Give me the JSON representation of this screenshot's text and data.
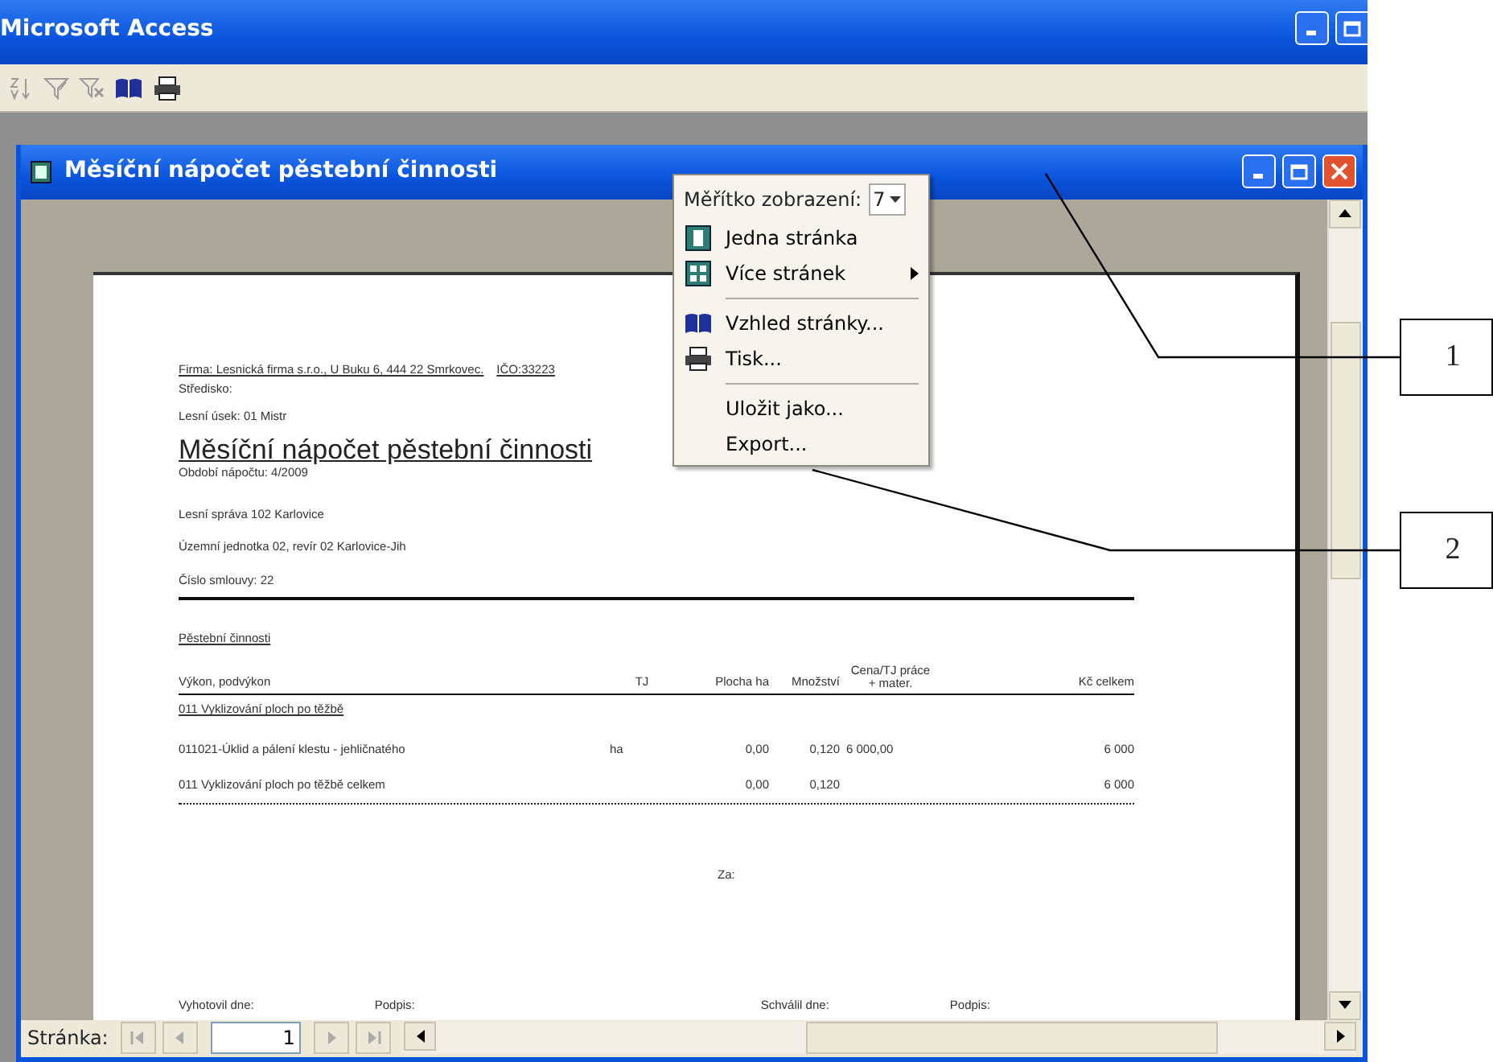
{
  "app": {
    "title": "Microsoft Access"
  },
  "toolbar": [
    {
      "kind": "sort",
      "disabled": true
    },
    {
      "kind": "filter",
      "disabled": true
    },
    {
      "kind": "remove-filter",
      "disabled": true
    },
    {
      "kind": "book",
      "disabled": false
    },
    {
      "kind": "print",
      "disabled": false
    }
  ],
  "document_window": {
    "title": "Měsíční nápočet pěstební činnosti"
  },
  "report": {
    "company": "Firma:  Lesnická firma s.r.o., U Buku 6, 444 22 Smrkovec.",
    "ico": "IČO:33223",
    "lines_top": [
      "Středisko:",
      "Lesní úsek: 01 Mistr"
    ],
    "title": "Měsíční nápočet pěstební činnosti",
    "period": "Období nápočtu:  4/2009",
    "lines_bottom": [
      "Lesní správa 102 Karlovice",
      "Územní jednotka 02, revír 02 Karlovice-Jih",
      "Číslo smlouvy:  22"
    ],
    "section": "Pěstební činnosti",
    "columns": [
      "Výkon, podvýkon",
      "TJ",
      "Plocha ha",
      "Množství",
      "Cena/TJ práce + mater.",
      "Kč celkem"
    ],
    "rows": [
      {
        "kind": "group",
        "cells": [
          "011  Vyklizování ploch po těžbě"
        ]
      },
      {
        "kind": "item",
        "cells": [
          "011021-Úklid a pálení klestu - jehličnatého",
          "ha",
          "0,00",
          "0,120",
          "6 000,00",
          "6 000"
        ]
      },
      {
        "kind": "total",
        "cells": [
          "011  Vyklizování ploch po těžbě celkem",
          "",
          "0,00",
          "0,120",
          "",
          "6 000"
        ]
      }
    ],
    "za": "Za:",
    "signatures": [
      "Vyhotovil dne:",
      "Podpis:",
      "Schválil dne:",
      "Podpis:"
    ]
  },
  "context_menu": {
    "zoom_label": "Měřítko zobrazení:",
    "zoom_value": "7",
    "items": [
      {
        "kind": "one-page",
        "label": "Jedna stránka",
        "submenu": false
      },
      {
        "kind": "multi-page",
        "label": "Více stránek",
        "submenu": true
      },
      {
        "kind": "separator"
      },
      {
        "kind": "book",
        "label": "Vzhled stránky...",
        "submenu": false
      },
      {
        "kind": "print",
        "label": "Tisk...",
        "submenu": false
      },
      {
        "kind": "separator"
      },
      {
        "kind": "plain",
        "label": "Uložit jako...",
        "submenu": false
      },
      {
        "kind": "plain",
        "label": "Export...",
        "submenu": false
      }
    ]
  },
  "navigation": {
    "label": "Stránka:",
    "page": "1",
    "buttons": [
      {
        "kind": "first"
      },
      {
        "kind": "prev"
      },
      {
        "kind": "next"
      },
      {
        "kind": "last"
      }
    ]
  },
  "callouts": [
    {
      "label": "1"
    },
    {
      "label": "2"
    }
  ]
}
